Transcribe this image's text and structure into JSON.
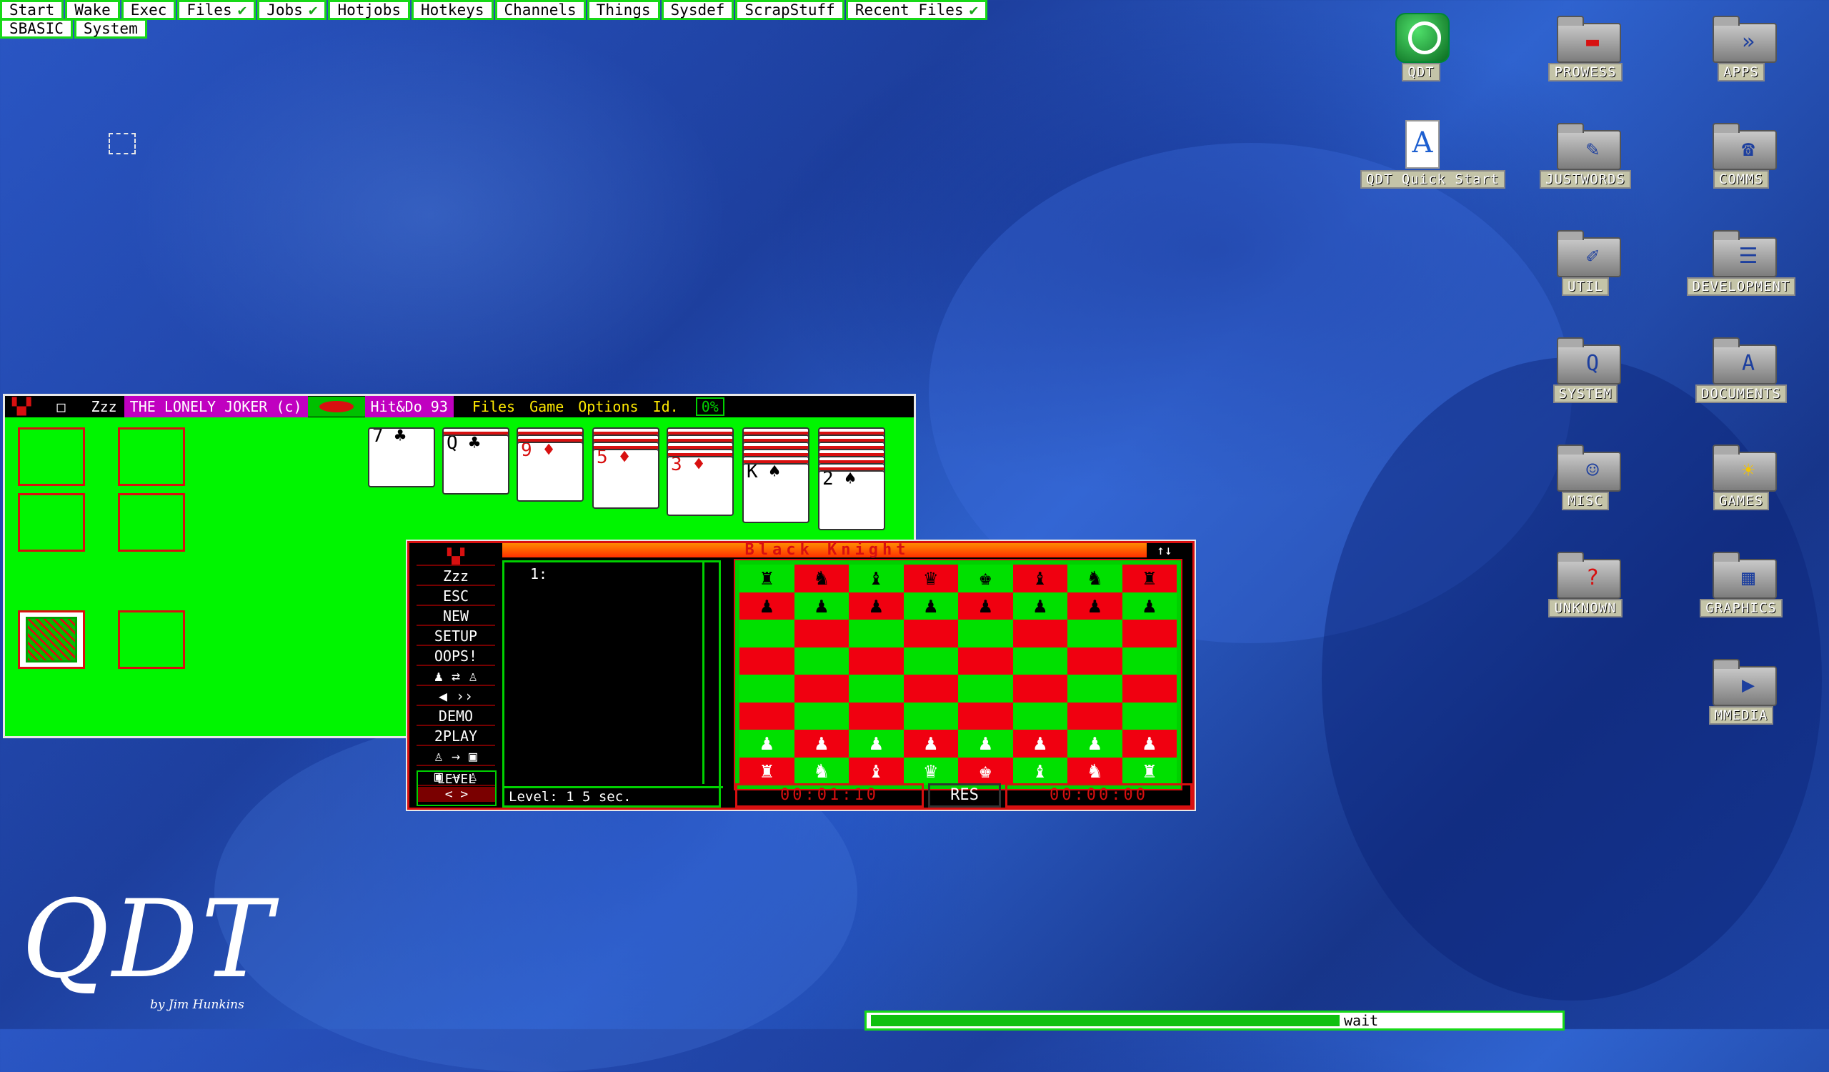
{
  "menubar": {
    "row1": [
      {
        "label": "Start",
        "arrow": ""
      },
      {
        "label": "Wake",
        "arrow": ""
      },
      {
        "label": "Exec",
        "arrow": ""
      },
      {
        "label": "Files",
        "arrow": "✔"
      },
      {
        "label": "Jobs",
        "arrow": "✔"
      },
      {
        "label": "Hotjobs",
        "arrow": ""
      },
      {
        "label": "Hotkeys",
        "arrow": ""
      },
      {
        "label": "Channels",
        "arrow": ""
      },
      {
        "label": "Things",
        "arrow": ""
      },
      {
        "label": "Sysdef",
        "arrow": ""
      },
      {
        "label": "ScrapStuff",
        "arrow": ""
      },
      {
        "label": "Recent Files",
        "arrow": "✔"
      }
    ],
    "row2": [
      {
        "label": "SBASIC"
      },
      {
        "label": "System"
      }
    ]
  },
  "desktop_icons": [
    {
      "label": "QDT",
      "icon": "qdt-logo-icon"
    },
    {
      "label": "PROWESS",
      "icon": "folder-icon"
    },
    {
      "label": "APPS",
      "icon": "folder-icon"
    },
    {
      "label": "QDT Quick Start",
      "icon": "document-icon"
    },
    {
      "label": "JUSTWORDS",
      "icon": "folder-icon"
    },
    {
      "label": "COMMS",
      "icon": "folder-icon"
    },
    {
      "label": "UTIL",
      "icon": "folder-icon"
    },
    {
      "label": "DEVELOPMENT",
      "icon": "folder-icon"
    },
    {
      "label": "SYSTEM",
      "icon": "folder-icon"
    },
    {
      "label": "DOCUMENTS",
      "icon": "folder-icon"
    },
    {
      "label": "MISC",
      "icon": "folder-icon"
    },
    {
      "label": "GAMES",
      "icon": "folder-icon"
    },
    {
      "label": "UNKNOWN",
      "icon": "folder-icon"
    },
    {
      "label": "GRAPHICS",
      "icon": "folder-icon"
    },
    {
      "label": "MMEDIA",
      "icon": "folder-icon"
    }
  ],
  "solitaire": {
    "sleep": "Zzz",
    "title": "THE LONELY JOKER (c)",
    "publisher": "Hit&Do 93",
    "menus": [
      "Files",
      "Game",
      "Options",
      "Id."
    ],
    "progress": "0%",
    "cards": [
      "7 ♣",
      "Q ♣",
      "9 ♦",
      "5 ♦",
      "3 ♦",
      "K ♠",
      "2 ♠"
    ]
  },
  "chess": {
    "title": "Black Knight",
    "arrows": "↑↓",
    "buttons": [
      "Zzz",
      "ESC",
      "NEW",
      "SETUP",
      "OOPS!",
      "DEMO",
      "2PLAY"
    ],
    "level_label": "LEVEL",
    "level_arrows": "<  >",
    "move_header": "1:",
    "level_status": "Level: 1   5 sec.",
    "clock_left": "00:01:10",
    "res_label": "RES",
    "clock_right": "00:00:00"
  },
  "status": {
    "text": "wait",
    "progress": 0.68
  },
  "logo": {
    "text": "QDT",
    "byline": "by Jim Hunkins"
  },
  "colors": {
    "menu_border": "#17d917",
    "solitaire_bg": "#00f500",
    "chess_red": "#f00010",
    "chess_green": "#00e000"
  }
}
